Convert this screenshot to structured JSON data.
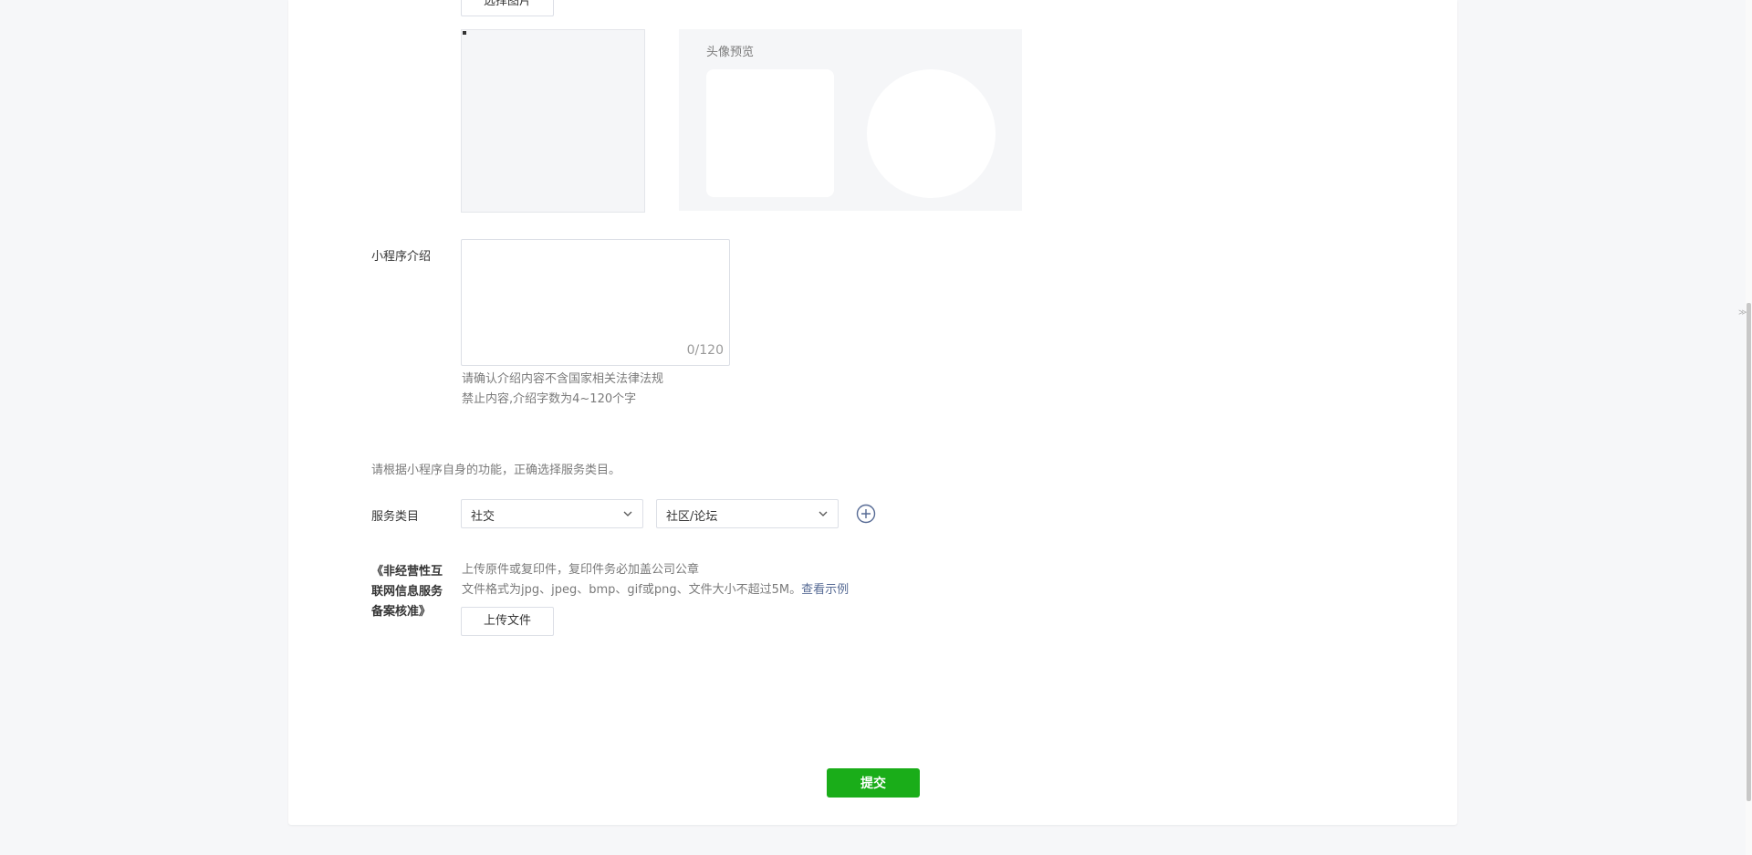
{
  "image_upload": {
    "select_image_label": "选择图片",
    "preview_title": "头像预览"
  },
  "intro": {
    "label": "小程序介绍",
    "value": "",
    "counter": "0/120",
    "hint_line1": "请确认介绍内容不含国家相关法律法规",
    "hint_line2": "禁止内容,介绍字数为4~120个字"
  },
  "category": {
    "note": "请根据小程序自身的功能，正确选择服务类目。",
    "label": "服务类目",
    "primary_value": "社交",
    "secondary_value": "社区/论坛"
  },
  "license": {
    "label_line1": "《非经营性互",
    "label_line2": "联网信息服务",
    "label_line3": "备案核准》",
    "hint_line1": "上传原件或复印件，复印件务必加盖公司公章",
    "hint_line2": "文件格式为jpg、jpeg、bmp、gif或png、文件大小不超过5M。",
    "example_link": "查看示例",
    "upload_button": "上传文件"
  },
  "submit_label": "提交",
  "colors": {
    "primary_green": "#1aad19",
    "link_blue": "#576b95",
    "page_bg": "#f6f7f9"
  }
}
